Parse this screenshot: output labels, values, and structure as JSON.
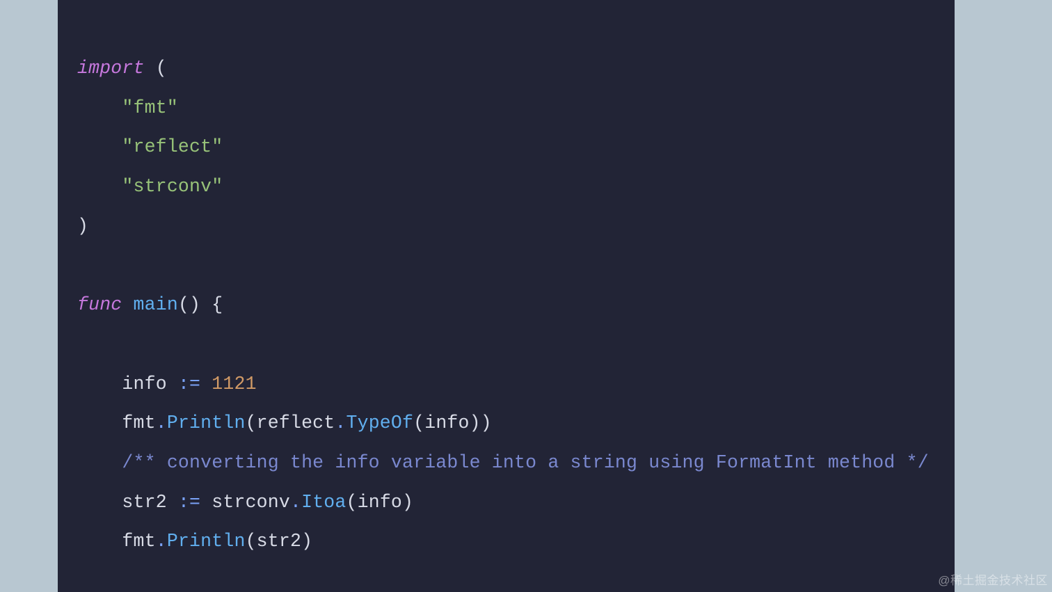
{
  "code": {
    "tokens": {
      "t01": "import",
      "t02": "(",
      "t03": "\"fmt\"",
      "t04": "\"reflect\"",
      "t05": "\"strconv\"",
      "t06": ")",
      "t07": "func",
      "t08": "main",
      "t09": "() {",
      "t10": "info ",
      "t11": ":=",
      "t12": " ",
      "t13": "1121",
      "t14": "fmt",
      "t15": ".",
      "t16": "Println",
      "t17": "(",
      "t18": "reflect",
      "t19": ".",
      "t20": "TypeOf",
      "t21": "(info))",
      "t22": "/** converting the info variable into a string using FormatInt method */",
      "t23": "str2 ",
      "t24": ":=",
      "t25": " strconv",
      "t26": ".",
      "t27": "Itoa",
      "t28": "(info)",
      "t29": "fmt",
      "t30": ".",
      "t31": "Println",
      "t32": "(str2)"
    }
  },
  "watermark": {
    "text": "@稀土掘金技术社区"
  }
}
